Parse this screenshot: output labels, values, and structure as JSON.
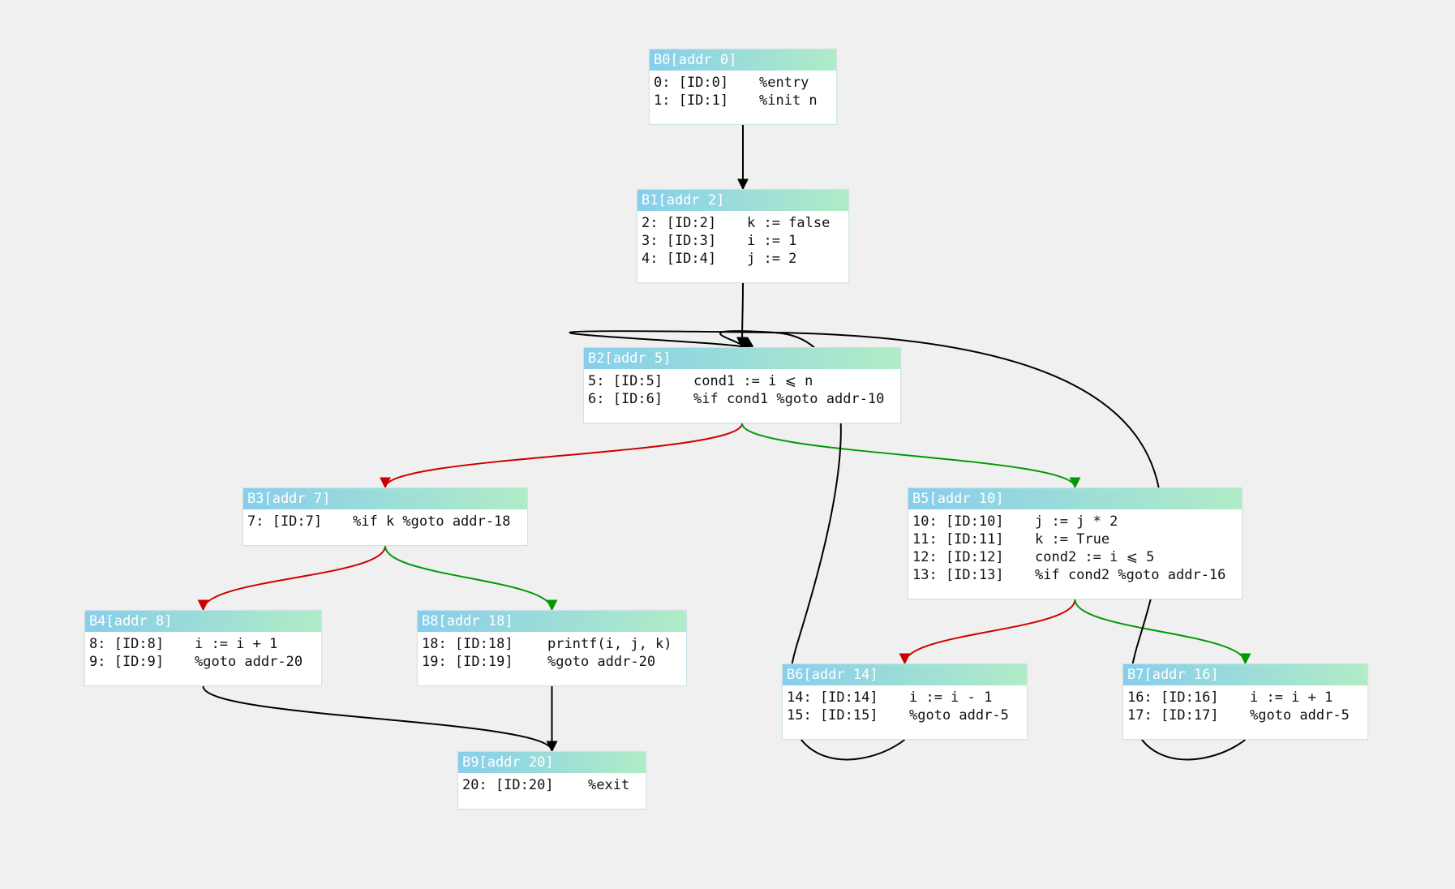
{
  "colors": {
    "background": "#f0f0f0",
    "header_start": "#87ceeb",
    "header_end": "#b0ecc6",
    "edge_default": "#000000",
    "edge_false": "#cc0000",
    "edge_true": "#009900"
  },
  "blocks": {
    "b0": {
      "title": "B0[addr 0]",
      "rows": [
        {
          "idx": "0: [ID:0]",
          "code": "%entry"
        },
        {
          "idx": "1: [ID:1]",
          "code": "%init n"
        }
      ]
    },
    "b1": {
      "title": "B1[addr 2]",
      "rows": [
        {
          "idx": "2: [ID:2]",
          "code": "k := false"
        },
        {
          "idx": "3: [ID:3]",
          "code": "i := 1"
        },
        {
          "idx": "4: [ID:4]",
          "code": "j := 2"
        }
      ]
    },
    "b2": {
      "title": "B2[addr 5]",
      "rows": [
        {
          "idx": "5: [ID:5]",
          "code": "cond1 := i ⩽ n"
        },
        {
          "idx": "6: [ID:6]",
          "code": "%if cond1 %goto addr-10"
        }
      ]
    },
    "b3": {
      "title": "B3[addr 7]",
      "rows": [
        {
          "idx": "7: [ID:7]",
          "code": "%if k %goto addr-18"
        }
      ]
    },
    "b4": {
      "title": "B4[addr 8]",
      "rows": [
        {
          "idx": "8: [ID:8]",
          "code": "i := i + 1"
        },
        {
          "idx": "9: [ID:9]",
          "code": "%goto addr-20"
        }
      ]
    },
    "b8": {
      "title": "B8[addr 18]",
      "rows": [
        {
          "idx": "18: [ID:18]",
          "code": "printf(i, j, k)"
        },
        {
          "idx": "19: [ID:19]",
          "code": "%goto addr-20"
        }
      ]
    },
    "b9": {
      "title": "B9[addr 20]",
      "rows": [
        {
          "idx": "20: [ID:20]",
          "code": "%exit"
        }
      ]
    },
    "b5": {
      "title": "B5[addr 10]",
      "rows": [
        {
          "idx": "10: [ID:10]",
          "code": "j := j * 2"
        },
        {
          "idx": "11: [ID:11]",
          "code": "k := True"
        },
        {
          "idx": "12: [ID:12]",
          "code": "cond2 := i ⩽ 5"
        },
        {
          "idx": "13: [ID:13]",
          "code": "%if cond2 %goto addr-16"
        }
      ]
    },
    "b6": {
      "title": "B6[addr 14]",
      "rows": [
        {
          "idx": "14: [ID:14]",
          "code": "i := i - 1"
        },
        {
          "idx": "15: [ID:15]",
          "code": "%goto addr-5"
        }
      ]
    },
    "b7": {
      "title": "B7[addr 16]",
      "rows": [
        {
          "idx": "16: [ID:16]",
          "code": "i := i + 1"
        },
        {
          "idx": "17: [ID:17]",
          "code": "%goto addr-5"
        }
      ]
    }
  },
  "edges": [
    {
      "from": "b0",
      "to": "b1",
      "kind": "default"
    },
    {
      "from": "b1",
      "to": "b2",
      "kind": "default"
    },
    {
      "from": "b2",
      "to": "b3",
      "kind": "false"
    },
    {
      "from": "b2",
      "to": "b5",
      "kind": "true"
    },
    {
      "from": "b3",
      "to": "b4",
      "kind": "false"
    },
    {
      "from": "b3",
      "to": "b8",
      "kind": "true"
    },
    {
      "from": "b4",
      "to": "b9",
      "kind": "default"
    },
    {
      "from": "b8",
      "to": "b9",
      "kind": "default"
    },
    {
      "from": "b5",
      "to": "b6",
      "kind": "false"
    },
    {
      "from": "b5",
      "to": "b7",
      "kind": "true"
    },
    {
      "from": "b6",
      "to": "b2",
      "kind": "default"
    },
    {
      "from": "b7",
      "to": "b2",
      "kind": "default"
    }
  ]
}
